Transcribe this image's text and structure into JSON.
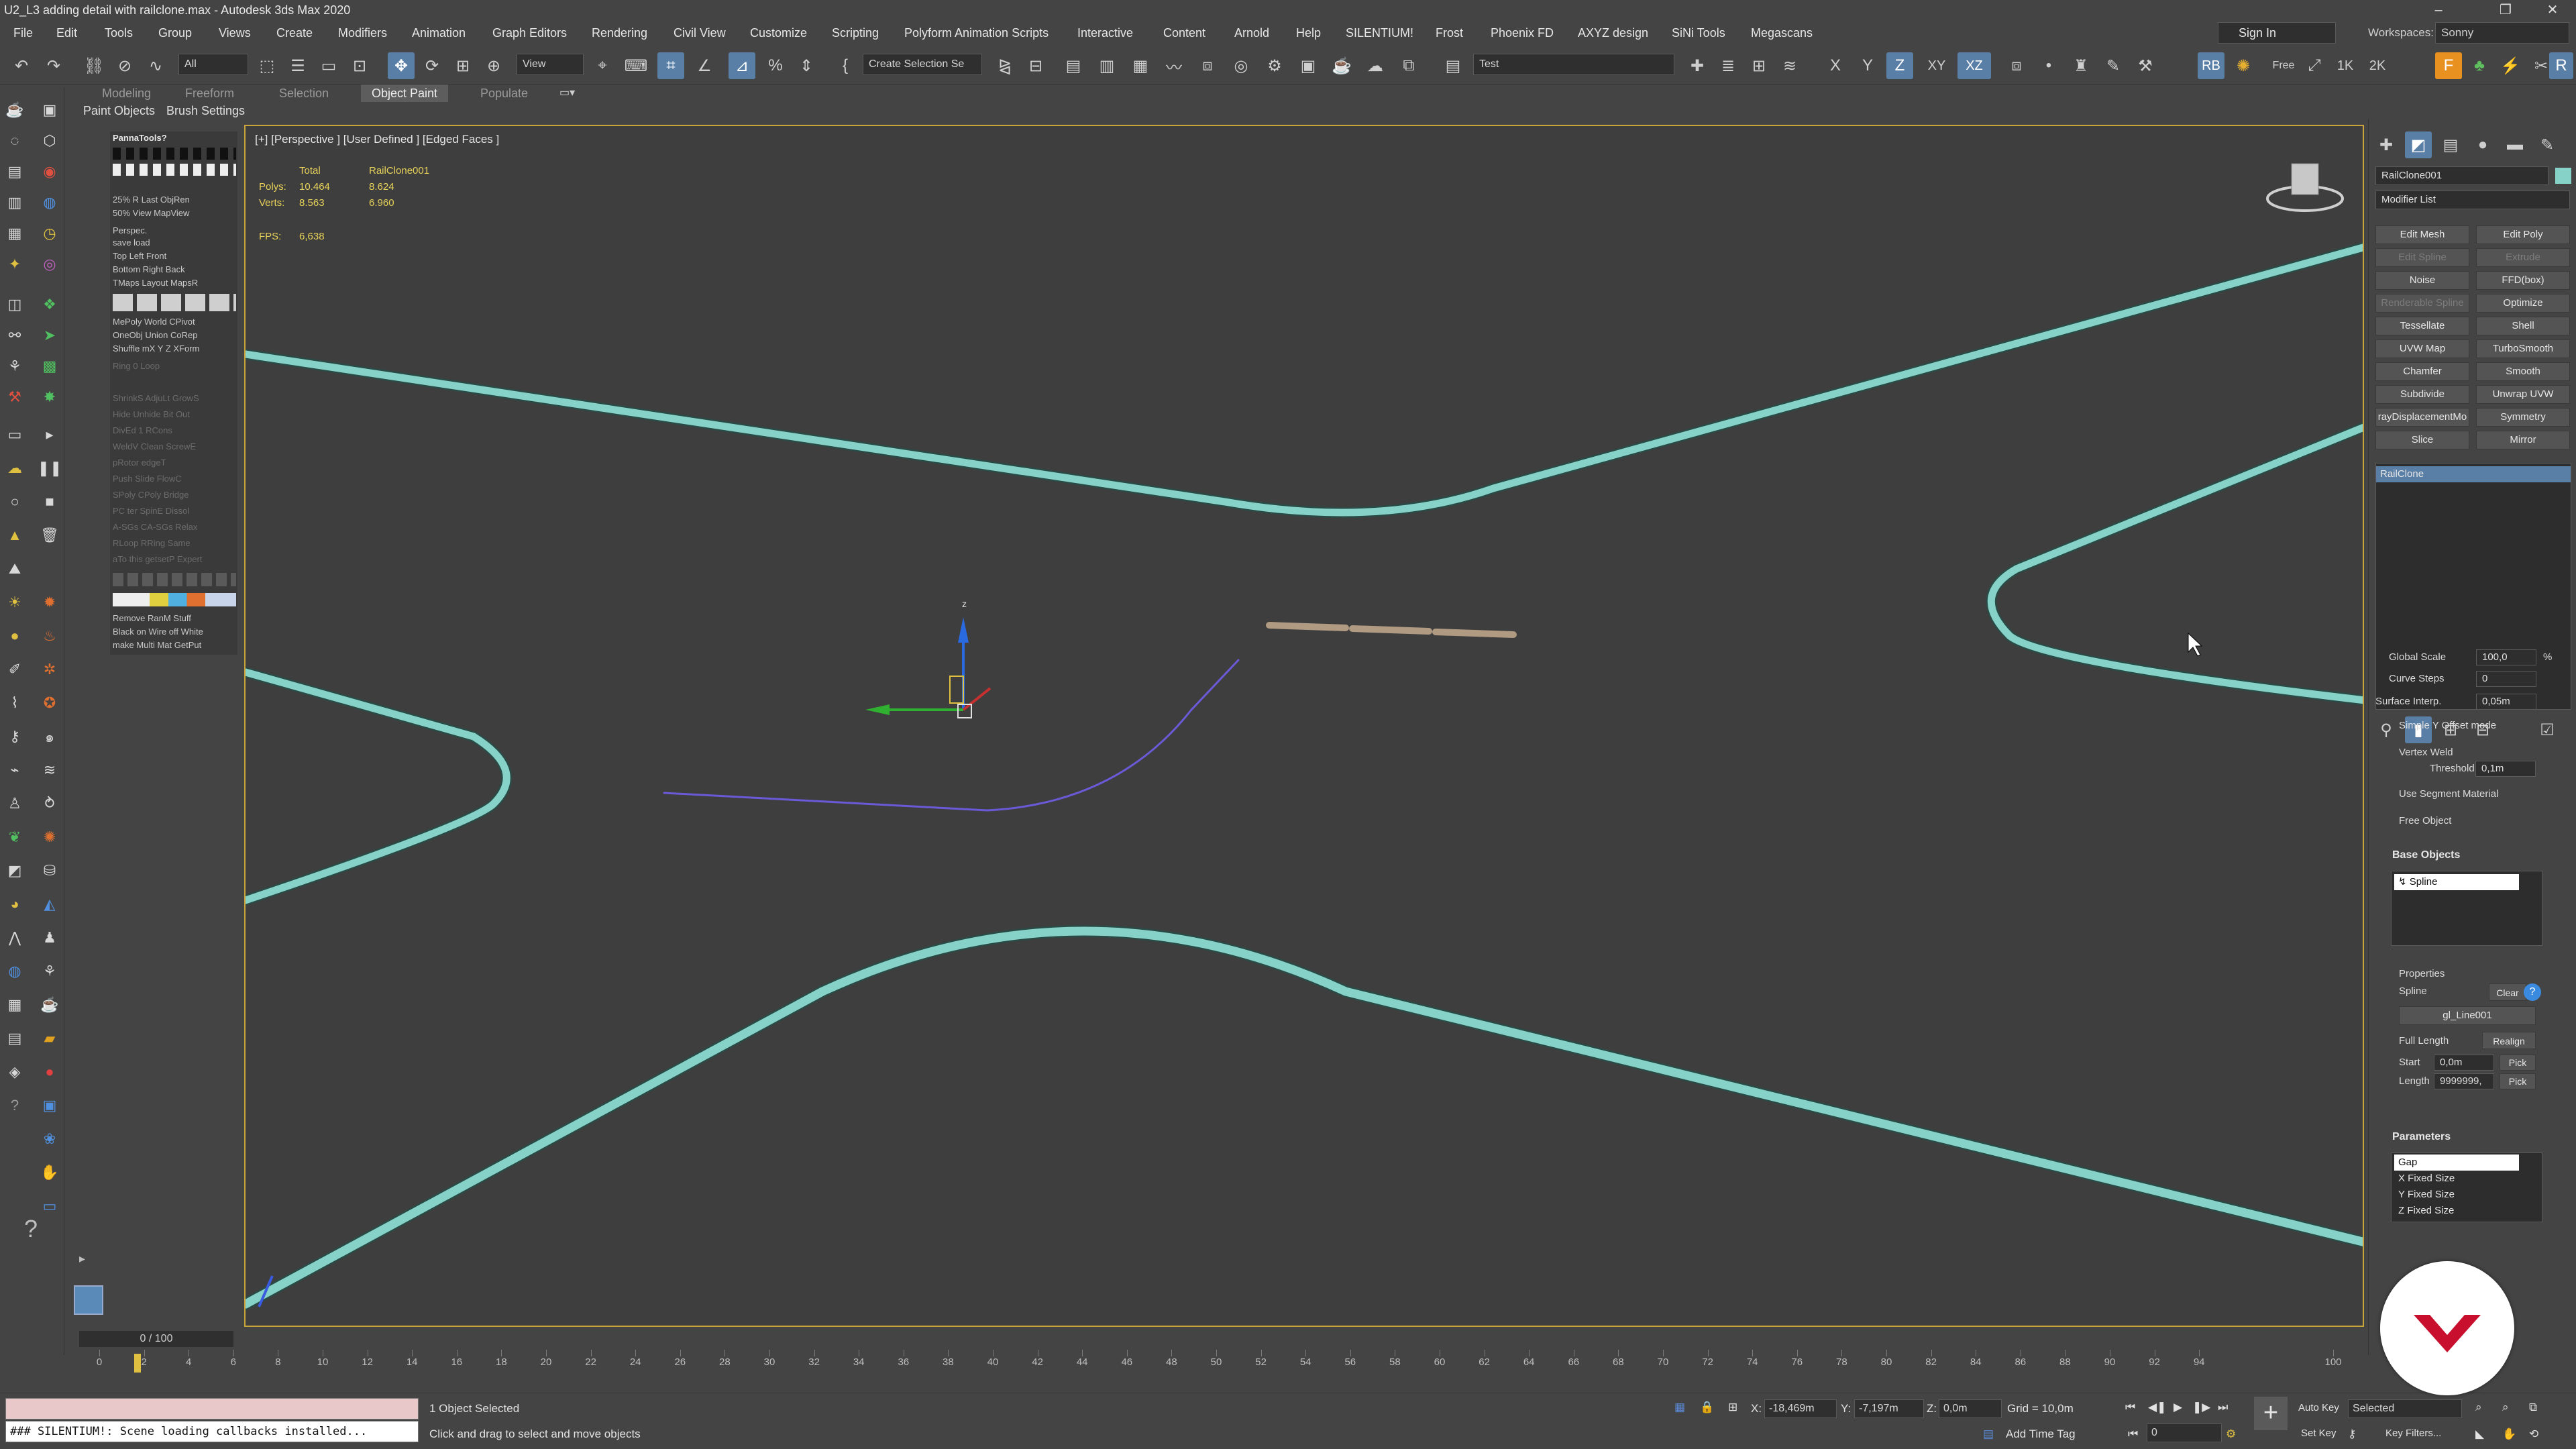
{
  "app": {
    "title": "U2_L3 adding detail with railclone.max - Autodesk 3ds Max 2020",
    "sign_in": "Sign In",
    "workspaces_label": "Workspaces:",
    "workspaces_value": "Sonny"
  },
  "menu": [
    "File",
    "Edit",
    "Tools",
    "Group",
    "Views",
    "Create",
    "Modifiers",
    "Animation",
    "Graph Editors",
    "Rendering",
    "Civil View",
    "Customize",
    "Scripting",
    "Polyform Animation Scripts",
    "Interactive",
    "Content",
    "Arnold",
    "Help",
    "SILENTIUM!",
    "Frost",
    "Phoenix FD",
    "AXYZ design",
    "SiNi Tools",
    "Megascans"
  ],
  "toolbar": {
    "selection_filter": "All",
    "ref_coord": "View",
    "named_selection": "Create Selection Se",
    "layer": "Test",
    "axis_x": "X",
    "axis_y": "Y",
    "axis_z": "Z",
    "axis_xy": "XY",
    "axis_xz": "XZ",
    "res_1k": "1K",
    "res_2k": "2K"
  },
  "ribbon": {
    "tabs": [
      "Modeling",
      "Freeform",
      "Selection",
      "Object Paint",
      "Populate"
    ],
    "active_tab": "Object Paint",
    "sub": [
      "Paint Objects",
      "Brush Settings"
    ]
  },
  "left_panel": {
    "title": "PannaTools?",
    "rows": [
      {
        "text": "25%   R   Last  ObjRen",
        "dim": false
      },
      {
        "text": "50%        View  MapView",
        "dim": false
      },
      {
        "text": "   Perspec.",
        "dim": false
      },
      {
        "text": "   save  load",
        "dim": false
      },
      {
        "text": "Top    Left   Front",
        "dim": false
      },
      {
        "text": "Bottom Right  Back",
        "dim": false
      },
      {
        "text": "TMaps Layout MapsR",
        "dim": false
      },
      {
        "text": "MePoly World CPivot",
        "dim": false
      },
      {
        "text": "OneObj Union CoRep",
        "dim": false
      },
      {
        "text": "Shuffle mX Y Z XForm",
        "dim": false
      },
      {
        "text": "Ring   0      Loop",
        "dim": true
      },
      {
        "text": "ShrinkS AdjuLt GrowS",
        "dim": true
      },
      {
        "text": "Hide  Unhide  Bit Out",
        "dim": true
      },
      {
        "text": "DivEd  1  RCons",
        "dim": true
      },
      {
        "text": "WeldV Clean ScrewE",
        "dim": true
      },
      {
        "text": "pRotor     edgeT",
        "dim": true
      },
      {
        "text": "Push  Slide FlowC",
        "dim": true
      },
      {
        "text": "SPoly CPoly Bridge",
        "dim": true
      },
      {
        "text": "PC ter SpinE Dissol",
        "dim": true
      },
      {
        "text": "A-SGs CA-SGs Relax",
        "dim": true
      },
      {
        "text": "RLoop RRing Same",
        "dim": true
      },
      {
        "text": "aTo this getsetP Expert",
        "dim": true
      },
      {
        "text": "Remove RanM Stuff",
        "dim": false
      },
      {
        "text": "Black on Wire off White",
        "dim": false
      },
      {
        "text": "make Multi Mat GetPut",
        "dim": false
      }
    ]
  },
  "viewport": {
    "label": "[+] [Perspective ] [User Defined ] [Edged Faces ]",
    "stats": {
      "col_total": "Total",
      "col_object": "RailClone001",
      "polys_label": "Polys:",
      "polys_total": "10.464",
      "polys_object": "8.624",
      "verts_label": "Verts:",
      "verts_total": "8.563",
      "verts_object": "6.960",
      "fps_label": "FPS:",
      "fps_value": "6,638"
    },
    "gizmo_z": "z",
    "rail_color": "#86d2c8",
    "spline_color": "#6a5ad8"
  },
  "right_panel": {
    "object_name": "RailClone001",
    "modifier_list": "Modifier List",
    "modifier_buttons": [
      {
        "label": "Edit Mesh",
        "dim": false
      },
      {
        "label": "Edit Poly",
        "dim": false
      },
      {
        "label": "Edit Spline",
        "dim": true
      },
      {
        "label": "Extrude",
        "dim": true
      },
      {
        "label": "Noise",
        "dim": false
      },
      {
        "label": "FFD(box)",
        "dim": false
      },
      {
        "label": "Renderable Spline",
        "dim": true
      },
      {
        "label": "Optimize",
        "dim": false
      },
      {
        "label": "Tessellate",
        "dim": false
      },
      {
        "label": "Shell",
        "dim": false
      },
      {
        "label": "UVW Map",
        "dim": false
      },
      {
        "label": "TurboSmooth",
        "dim": false
      },
      {
        "label": "Chamfer",
        "dim": false
      },
      {
        "label": "Smooth",
        "dim": false
      },
      {
        "label": "Subdivide",
        "dim": false
      },
      {
        "label": "Unwrap UVW",
        "dim": false
      },
      {
        "label": "rayDisplacementMo",
        "dim": false
      },
      {
        "label": "Symmetry",
        "dim": false
      },
      {
        "label": "Slice",
        "dim": false
      },
      {
        "label": "Mirror",
        "dim": false
      }
    ],
    "stack_item": "RailClone",
    "params": {
      "global_scale_label": "Global Scale",
      "global_scale_value": "100,0",
      "global_scale_unit": "%",
      "curve_steps_label": "Curve Steps",
      "curve_steps_value": "0",
      "surface_interp_label": "Surface Interp.",
      "surface_interp_value": "0,05m",
      "simple_y_offset": "Simple Y Offset mode",
      "vertex_weld": "Vertex Weld",
      "threshold_label": "Threshold",
      "threshold_value": "0,1m",
      "use_segment_material": "Use Segment Material",
      "free_object": "Free Object"
    },
    "base_objects": {
      "title": "Base Objects",
      "items": [
        "Spline"
      ],
      "properties_label": "Properties",
      "spline_label": "Spline",
      "clear": "Clear",
      "spline_value": "gl_Line001",
      "full_length": "Full Length",
      "realign": "Realign",
      "start_label": "Start",
      "start_value": "0,0m",
      "length_label": "Length",
      "length_value": "9999999,",
      "pick": "Pick"
    },
    "parameters": {
      "title": "Parameters",
      "items": [
        "Gap",
        "X Fixed Size",
        "Y Fixed Size",
        "Z Fixed Size"
      ]
    }
  },
  "timeline": {
    "slider": "0 / 100",
    "ticks": [
      "0",
      "2",
      "4",
      "6",
      "8",
      "10",
      "12",
      "14",
      "16",
      "18",
      "20",
      "22",
      "24",
      "26",
      "28",
      "30",
      "32",
      "34",
      "36",
      "38",
      "40",
      "42",
      "44",
      "46",
      "48",
      "50",
      "52",
      "54",
      "56",
      "58",
      "60",
      "62",
      "64",
      "66",
      "68",
      "70",
      "72",
      "74",
      "76",
      "78",
      "80",
      "82",
      "84",
      "86",
      "88",
      "90",
      "92",
      "94",
      "100"
    ]
  },
  "status": {
    "maxscript_output": "",
    "maxscript_listener": "### SILENTIUM!: Scene loading callbacks installed...",
    "selection": "1 Object Selected",
    "prompt": "Click and drag to select and move objects",
    "x_label": "X:",
    "x_value": "-18,469m",
    "y_label": "Y:",
    "y_value": "-7,197m",
    "z_label": "Z:",
    "z_value": "0,0m",
    "grid": "Grid = 10,0m",
    "add_time_tag": "Add Time Tag",
    "auto_key": "Auto Key",
    "set_key": "Set Key",
    "key_mode": "Selected",
    "key_filters": "Key Filters...",
    "frame": "0"
  },
  "badge_color": "#c8102e"
}
